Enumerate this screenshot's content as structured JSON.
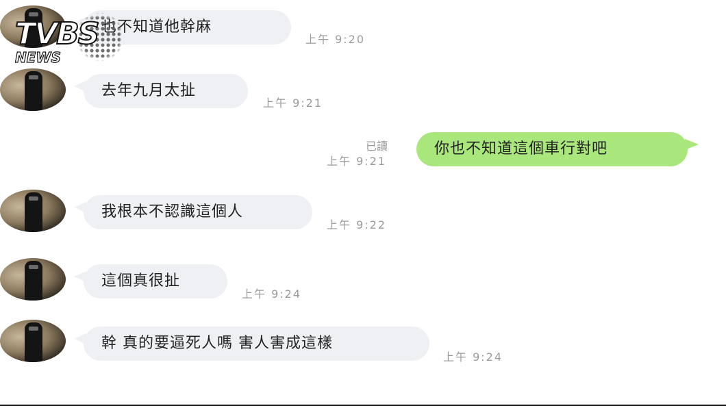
{
  "watermark": {
    "main": "TVBS",
    "sub": "NEWS"
  },
  "messages": [
    {
      "side": "in",
      "text": "也不知道他幹麻",
      "time": "上午 9:20"
    },
    {
      "side": "in",
      "text": "去年九月太扯",
      "time": "上午 9:21"
    },
    {
      "side": "out",
      "text": "你也不知道這個車行對吧",
      "time": "上午 9:21",
      "status": "已讀"
    },
    {
      "side": "in",
      "text": "我根本不認識這個人",
      "time": "上午 9:22"
    },
    {
      "side": "in",
      "text": "這個真很扯",
      "time": "上午 9:24"
    },
    {
      "side": "in",
      "text": "幹 真的要逼死人嗎 害人害成這樣",
      "time": "上午 9:24"
    }
  ],
  "colors": {
    "incoming_bubble": "#eef0f4",
    "outgoing_bubble": "#a9e77c",
    "meta_text": "#9a9a9a"
  }
}
